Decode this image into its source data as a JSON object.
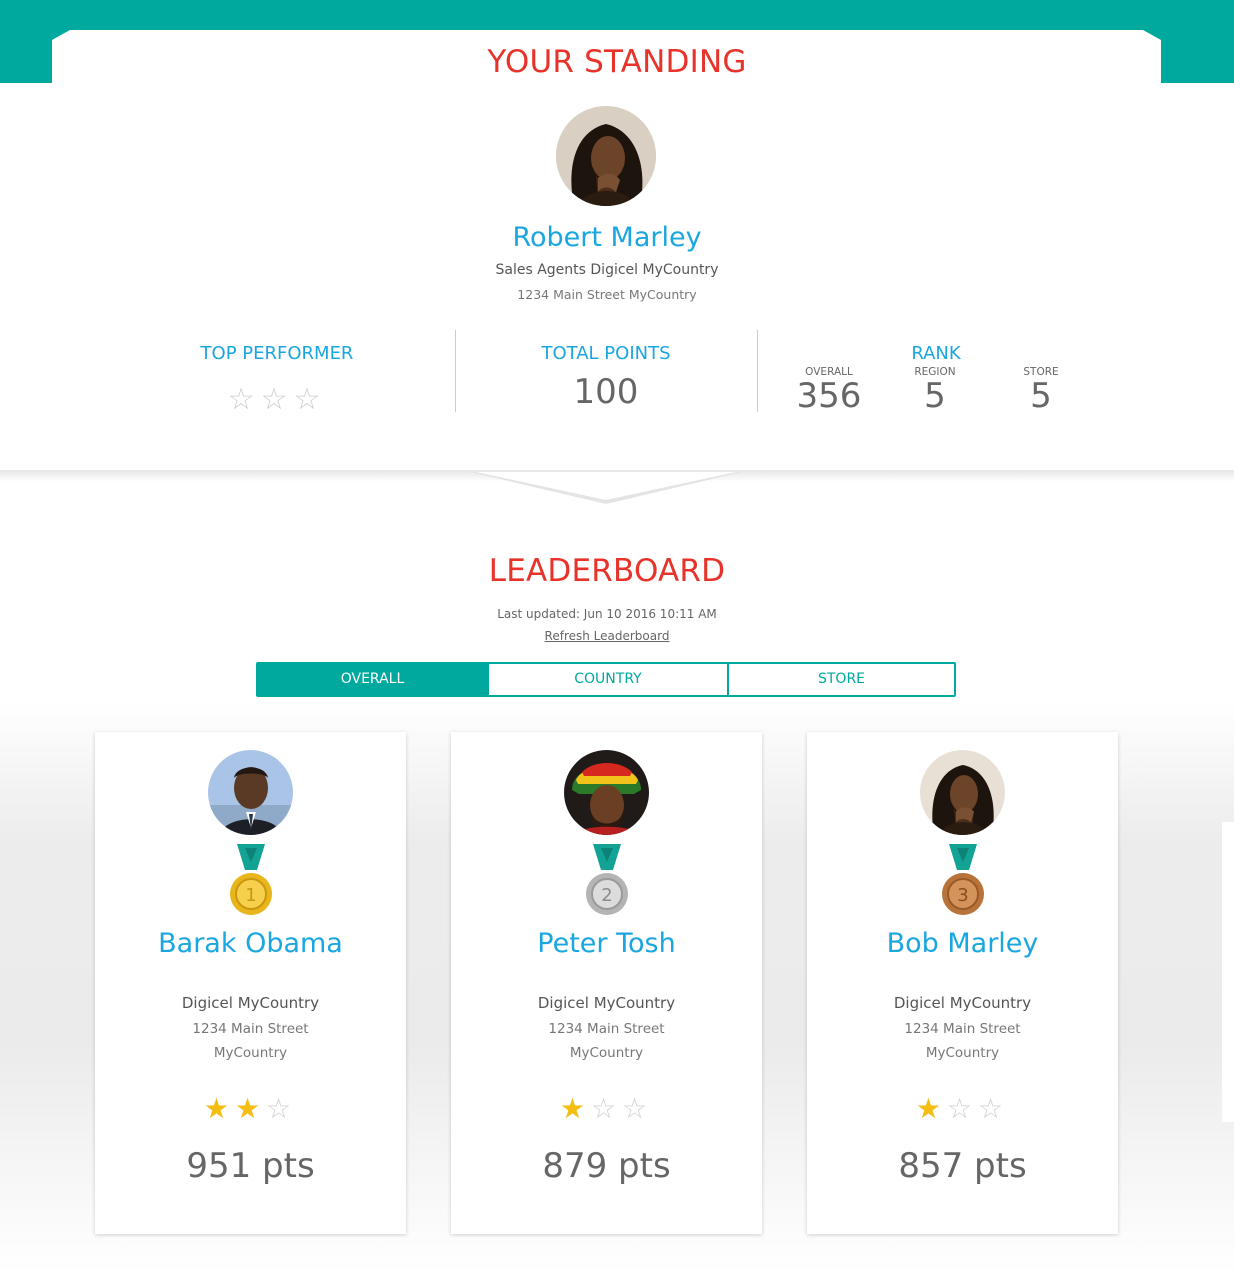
{
  "colors": {
    "teal": "#00a99d",
    "red": "#e8332a",
    "blue": "#1aa6e0",
    "star": "#f3bd12"
  },
  "standing": {
    "title": "YOUR STANDING",
    "user": {
      "name": "Robert Marley",
      "role": "Sales Agents Digicel MyCountry",
      "address": "1234 Main Street MyCountry",
      "avatar_icon": "user-photo-dreadlocks"
    },
    "top_performer": {
      "label": "TOP PERFORMER",
      "stars": 0,
      "max_stars": 3
    },
    "total_points": {
      "label": "TOTAL POINTS",
      "value": "100"
    },
    "rank": {
      "label": "RANK",
      "overall": {
        "label": "OVERALL",
        "value": "356"
      },
      "region": {
        "label": "REGION",
        "value": "5"
      },
      "store": {
        "label": "STORE",
        "value": "5"
      }
    }
  },
  "leaderboard": {
    "title": "LEADERBOARD",
    "last_updated": "Last updated: Jun 10 2016 10:11 AM",
    "refresh_label": "Refresh Leaderboard",
    "tabs": [
      {
        "label": "OVERALL",
        "active": true
      },
      {
        "label": "COUNTRY",
        "active": false
      },
      {
        "label": "STORE",
        "active": false
      }
    ],
    "entries": [
      {
        "rank": 1,
        "medal": "gold-medal-icon",
        "name": "Barak Obama",
        "company": "Digicel MyCountry",
        "street": "1234 Main Street",
        "country": "MyCountry",
        "stars": 2,
        "max_stars": 3,
        "points": "951 pts"
      },
      {
        "rank": 2,
        "medal": "silver-medal-icon",
        "name": "Peter Tosh",
        "company": "Digicel MyCountry",
        "street": "1234 Main Street",
        "country": "MyCountry",
        "stars": 1,
        "max_stars": 3,
        "points": "879 pts"
      },
      {
        "rank": 3,
        "medal": "bronze-medal-icon",
        "name": "Bob Marley",
        "company": "Digicel MyCountry",
        "street": "1234 Main Street",
        "country": "MyCountry",
        "stars": 1,
        "max_stars": 3,
        "points": "857 pts"
      }
    ]
  }
}
